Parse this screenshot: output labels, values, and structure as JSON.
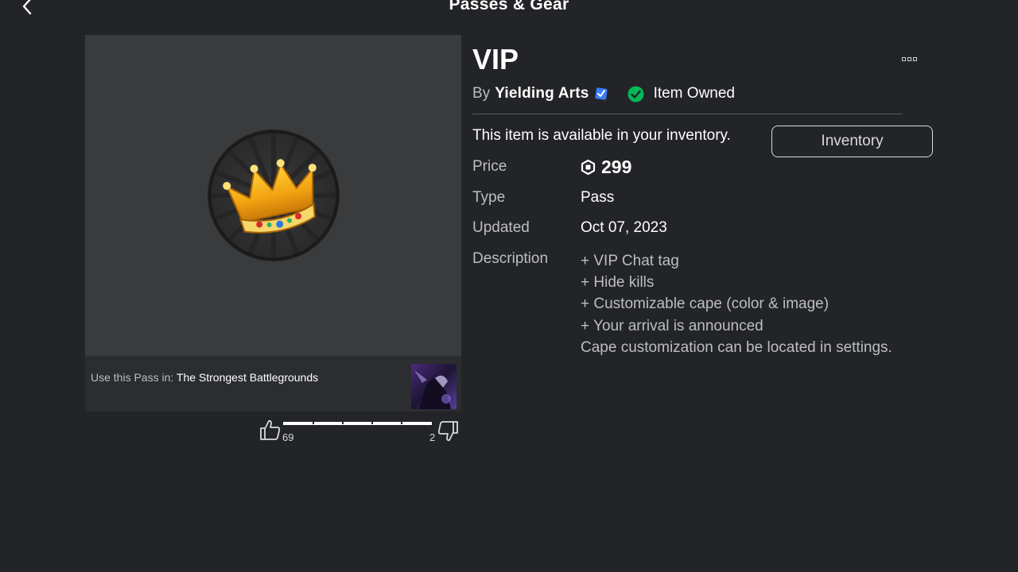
{
  "header": {
    "title": "Passes & Gear",
    "back_icon": "chevron-left-icon"
  },
  "thumbnail": {
    "icon": "crown-icon",
    "use_label": "Use this Pass in:",
    "game_name": "The Strongest Battlegrounds"
  },
  "votes": {
    "up_count": "69",
    "down_count": "2",
    "up_ratio": 0.97
  },
  "item": {
    "title": "VIP",
    "by_label": "By",
    "creator": "Yielding Arts",
    "owned_label": "Item Owned",
    "available_text": "This item is available in your inventory.",
    "inventory_button": "Inventory"
  },
  "details": {
    "price_label": "Price",
    "price_value": "299",
    "type_label": "Type",
    "type_value": "Pass",
    "updated_label": "Updated",
    "updated_value": "Oct 07, 2023",
    "description_label": "Description",
    "description_lines": [
      "+ VIP Chat tag",
      "+ Hide kills",
      "+ Customizable cape (color & image)",
      "+ Your arrival is announced",
      "Cape customization can be located in settings."
    ]
  },
  "colors": {
    "background": "#232427",
    "panel": "#393b3d",
    "verified": "#3a7bf6",
    "owned": "#02b757"
  }
}
